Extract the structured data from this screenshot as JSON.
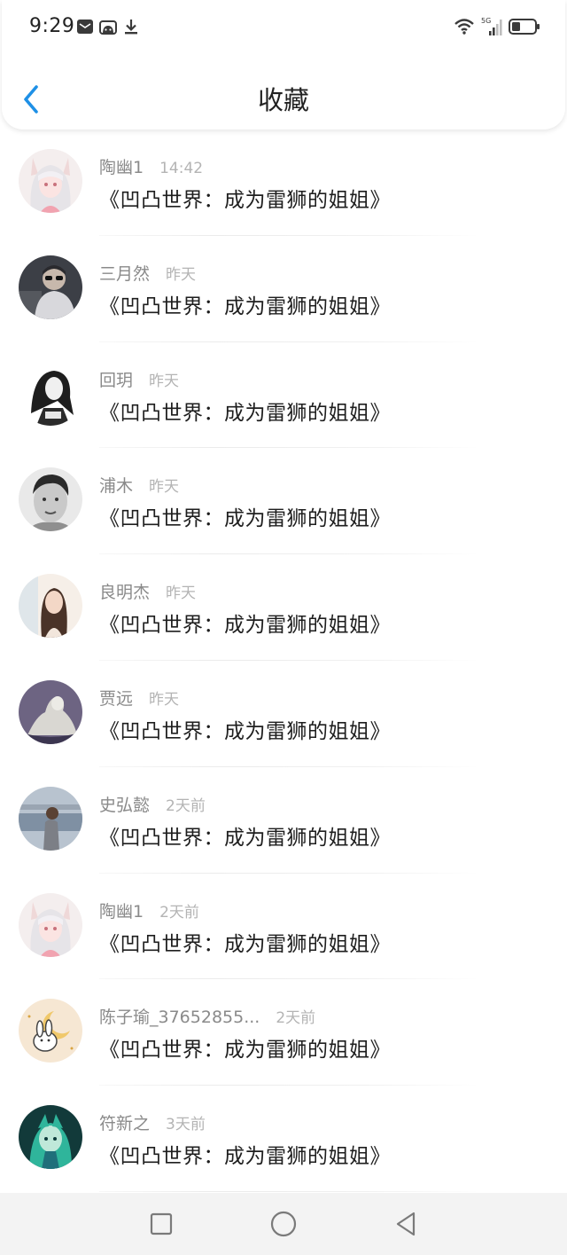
{
  "status_bar": {
    "time": "9:29",
    "left_icons": [
      "message-icon",
      "android-icon",
      "download-icon"
    ],
    "right_icons": [
      "wifi-icon",
      "signal-5g-icon",
      "battery-icon"
    ],
    "network_label": "5G"
  },
  "header": {
    "back_icon": "chevron-left-icon",
    "title": "收藏"
  },
  "accent_color": "#1e90e6",
  "favorites": [
    {
      "user": "陶幽1",
      "time": "14:42",
      "text": "《凹凸世界：成为雷狮的姐姐》",
      "avatar": "anime-girl-white-hair"
    },
    {
      "user": "三月然",
      "time": "昨天",
      "text": "《凹凸世界：成为雷狮的姐姐》",
      "avatar": "man-sunglasses"
    },
    {
      "user": "回玥",
      "time": "昨天",
      "text": "《凹凸世界：成为雷狮的姐姐》",
      "avatar": "girl-sketch-bw"
    },
    {
      "user": "浦木",
      "time": "昨天",
      "text": "《凹凸世界：成为雷狮的姐姐》",
      "avatar": "man-bw-portrait"
    },
    {
      "user": "良明杰",
      "time": "昨天",
      "text": "《凹凸世界：成为雷狮的姐姐》",
      "avatar": "girl-long-hair"
    },
    {
      "user": "贾远",
      "time": "昨天",
      "text": "《凹凸世界：成为雷狮的姐姐》",
      "avatar": "statue-purple"
    },
    {
      "user": "史弘懿",
      "time": "2天前",
      "text": "《凹凸世界：成为雷狮的姐姐》",
      "avatar": "man-by-water"
    },
    {
      "user": "陶幽1",
      "time": "2天前",
      "text": "《凹凸世界：成为雷狮的姐姐》",
      "avatar": "anime-girl-white-hair"
    },
    {
      "user": "陈子瑜_37652855...",
      "time": "2天前",
      "text": "《凹凸世界：成为雷狮的姐姐》",
      "avatar": "cartoon-bunny-moon"
    },
    {
      "user": "符新之",
      "time": "3天前",
      "text": "《凹凸世界：成为雷狮的姐姐》",
      "avatar": "anime-cyan-character"
    }
  ],
  "nav_bar": {
    "buttons": [
      "recents-square-icon",
      "home-circle-icon",
      "back-triangle-icon"
    ]
  }
}
